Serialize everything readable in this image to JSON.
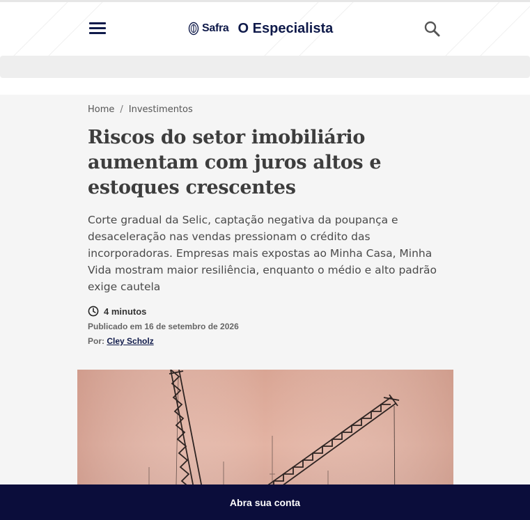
{
  "header": {
    "brand_name": "Safra",
    "site_title": "O Especialista",
    "menu_icon": "hamburger-menu-icon",
    "search_icon": "search-icon"
  },
  "breadcrumb": {
    "items": [
      "Home",
      "Investimentos"
    ],
    "separator": "/"
  },
  "article": {
    "title": "Riscos do setor imobiliário aumentam com juros altos e estoques crescentes",
    "lede": "Corte gradual da Selic, captação negativa da poupança e desaceleração nas vendas pressionam o crédito das incorporadoras. Empresas mais expostas ao Minha Casa, Minha Vida mostram maior resiliência, enquanto o médio e alto padrão exige cautela",
    "reading_time": "4 minutos",
    "published": "Publicado em 16 de setembro de 2026",
    "author_prefix": "Por:",
    "author_name": "Cley Scholz"
  },
  "cta": {
    "label": "Abra sua conta"
  },
  "colors": {
    "brand_navy": "#0f1a4a",
    "cta_background": "#0b0d3b",
    "article_background": "#f5f5f5"
  }
}
